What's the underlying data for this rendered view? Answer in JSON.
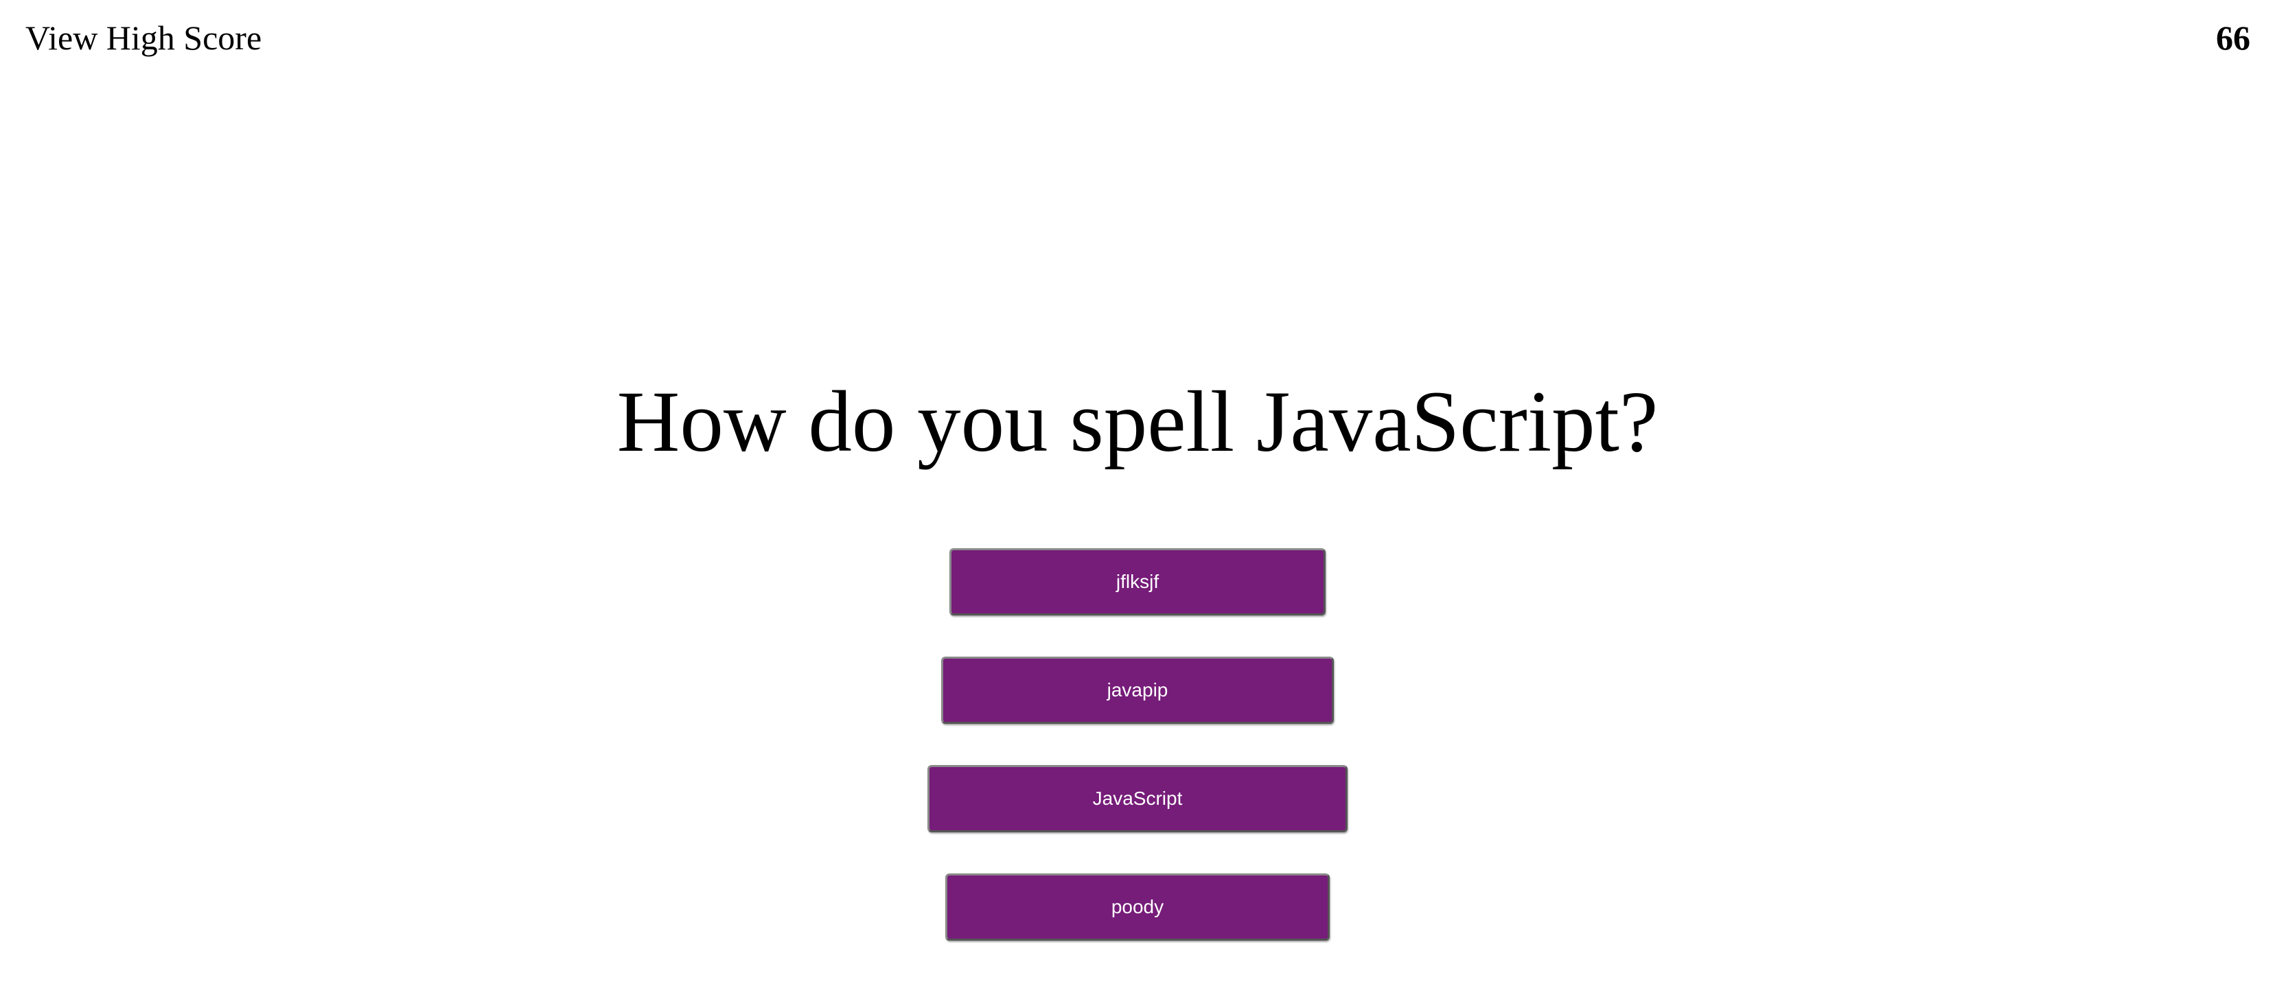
{
  "header": {
    "high_score_link": "View High Score",
    "timer": "66"
  },
  "quiz": {
    "question": "How do you spell JavaScript?",
    "answers": [
      {
        "label": "jflksjf"
      },
      {
        "label": "javapip"
      },
      {
        "label": "JavaScript"
      },
      {
        "label": "poody"
      }
    ]
  },
  "colors": {
    "button_background": "#761c79",
    "button_text": "#ffffff",
    "page_background": "#ffffff"
  }
}
